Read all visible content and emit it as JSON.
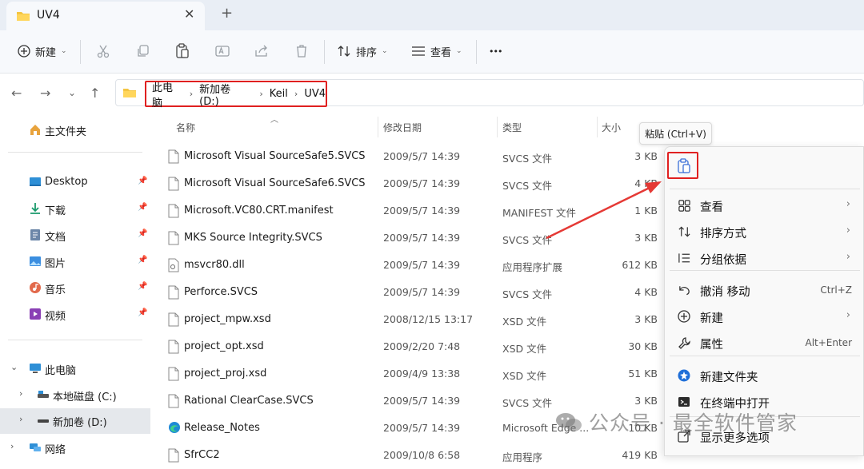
{
  "tab": {
    "title": "UV4",
    "close_glyph": "✕",
    "new_tab_glyph": "+"
  },
  "toolbar": {
    "new_label": "新建",
    "sort_label": "排序",
    "view_label": "查看",
    "more_glyph": "•••"
  },
  "address": {
    "crumbs": [
      "此电脑",
      "新加卷 (D:)",
      "Keil",
      "UV4"
    ],
    "highlight_color": "#e02020"
  },
  "sidebar": {
    "home": "主文件夹",
    "quick": [
      {
        "label": "Desktop",
        "icon": "desktop-icon"
      },
      {
        "label": "下载",
        "icon": "download-icon"
      },
      {
        "label": "文档",
        "icon": "document-icon"
      },
      {
        "label": "图片",
        "icon": "pictures-icon"
      },
      {
        "label": "音乐",
        "icon": "music-icon"
      },
      {
        "label": "视频",
        "icon": "video-icon"
      }
    ],
    "this_pc": "此电脑",
    "drives": [
      "本地磁盘 (C:)",
      "新加卷 (D:)"
    ],
    "network": "网络"
  },
  "columns": {
    "name": "名称",
    "date": "修改日期",
    "type": "类型",
    "size": "大小"
  },
  "files": [
    {
      "name": "Microsoft Visual SourceSafe5.SVCS",
      "date": "2009/5/7 14:39",
      "type": "SVCS 文件",
      "size": "3 KB"
    },
    {
      "name": "Microsoft Visual SourceSafe6.SVCS",
      "date": "2009/5/7 14:39",
      "type": "SVCS 文件",
      "size": "4 KB"
    },
    {
      "name": "Microsoft.VC80.CRT.manifest",
      "date": "2009/5/7 14:39",
      "type": "MANIFEST 文件",
      "size": "1 KB"
    },
    {
      "name": "MKS Source Integrity.SVCS",
      "date": "2009/5/7 14:39",
      "type": "SVCS 文件",
      "size": "3 KB"
    },
    {
      "name": "msvcr80.dll",
      "date": "2009/5/7 14:39",
      "type": "应用程序扩展",
      "size": "612 KB"
    },
    {
      "name": "Perforce.SVCS",
      "date": "2009/5/7 14:39",
      "type": "SVCS 文件",
      "size": "4 KB"
    },
    {
      "name": "project_mpw.xsd",
      "date": "2008/12/15 13:17",
      "type": "XSD 文件",
      "size": "3 KB"
    },
    {
      "name": "project_opt.xsd",
      "date": "2009/2/20 7:48",
      "type": "XSD 文件",
      "size": "30 KB"
    },
    {
      "name": "project_proj.xsd",
      "date": "2009/4/9 13:38",
      "type": "XSD 文件",
      "size": "51 KB"
    },
    {
      "name": "Rational ClearCase.SVCS",
      "date": "2009/5/7 14:39",
      "type": "SVCS 文件",
      "size": "3 KB"
    },
    {
      "name": "Release_Notes",
      "date": "2009/5/7 14:39",
      "type": "Microsoft Edge ...",
      "size": "10 KB"
    },
    {
      "name": "SfrCC2",
      "date": "2009/10/8 6:58",
      "type": "应用程序",
      "size": "419 KB"
    }
  ],
  "context_menu": {
    "tooltip": "粘贴 (Ctrl+V)",
    "items": [
      {
        "label": "查看",
        "icon": "grid-view-icon",
        "arrow": "›",
        "shortcut": ""
      },
      {
        "label": "排序方式",
        "icon": "sort-icon",
        "arrow": "›",
        "shortcut": ""
      },
      {
        "label": "分组依据",
        "icon": "group-icon",
        "arrow": "›",
        "shortcut": ""
      },
      {
        "label": "撤消 移动",
        "icon": "undo-icon",
        "arrow": "",
        "shortcut": "Ctrl+Z"
      },
      {
        "label": "新建",
        "icon": "new-icon",
        "arrow": "›",
        "shortcut": ""
      },
      {
        "label": "属性",
        "icon": "wrench-icon",
        "arrow": "",
        "shortcut": "Alt+Enter"
      },
      {
        "label": "新建文件夹",
        "icon": "new-folder-icon",
        "arrow": "",
        "shortcut": ""
      },
      {
        "label": "在终端中打开",
        "icon": "terminal-icon",
        "arrow": "",
        "shortcut": ""
      },
      {
        "label": "显示更多选项",
        "icon": "more-options-icon",
        "arrow": "",
        "shortcut": ""
      }
    ]
  },
  "watermark": {
    "text": "公众号 · 最全软件管家"
  }
}
